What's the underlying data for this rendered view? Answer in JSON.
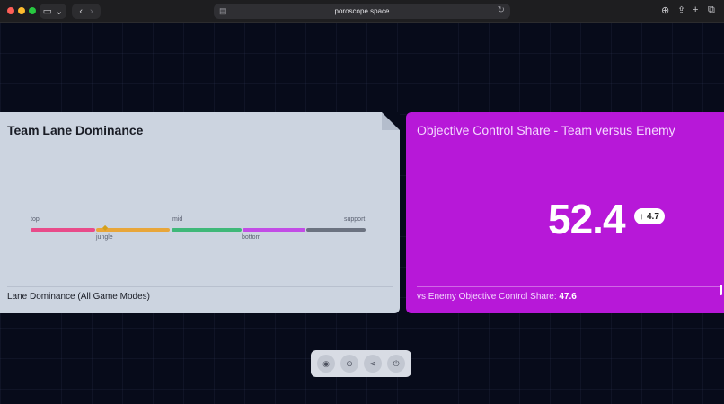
{
  "browser": {
    "url": "poroscope.space",
    "traffic_lights": [
      "#ff5f57",
      "#febc2e",
      "#28c840"
    ]
  },
  "lane_card": {
    "title": "Team Lane Dominance",
    "top_labels": [
      "top",
      "mid",
      "support"
    ],
    "bottom_labels": [
      "jungle",
      "bottom"
    ],
    "segment_colors": [
      "#e84b8a",
      "#e8a63a",
      "#3fb879",
      "#c24ce6",
      "#6b7280"
    ],
    "footer": "Lane Dominance (All Game Modes)"
  },
  "objective_card": {
    "title": "Objective Control Share - Team versus Enemy",
    "value": "52.4",
    "delta": "4.7",
    "footer_label": "vs Enemy Objective Control Share:",
    "footer_value": "47.6",
    "background": "#b718d8"
  },
  "toolbar": {
    "icons": [
      "github-icon",
      "record-icon",
      "share-icon",
      "power-icon"
    ]
  }
}
